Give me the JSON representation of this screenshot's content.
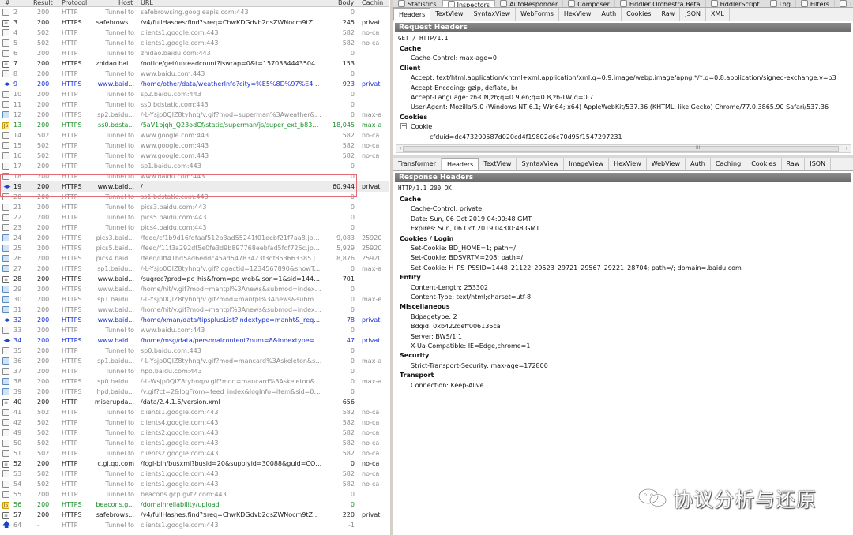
{
  "session_list": {
    "columns": [
      "#",
      "Result",
      "Protocol",
      "Host",
      "URL",
      "Body",
      "Cachin"
    ],
    "rows": [
      {
        "num": "2",
        "result": "200",
        "protocol": "HTTP",
        "host": "Tunnel to",
        "url": "safebrowsing.googleapis.com:443",
        "body": "0",
        "caching": "",
        "style": "tunnel",
        "icon": "lock-icon"
      },
      {
        "num": "3",
        "result": "200",
        "protocol": "HTTPS",
        "host": "safebrows...",
        "url": "/v4/fullHashes:find?$req=ChwKDGdvb2dsZWNocm9tZRIMN...",
        "body": "245",
        "caching": "privat",
        "style": "normal",
        "icon": "document-icon"
      },
      {
        "num": "4",
        "result": "502",
        "protocol": "HTTP",
        "host": "Tunnel to",
        "url": "clients1.google.com:443",
        "body": "582",
        "caching": "no-ca",
        "style": "tunnel",
        "icon": "lock-icon"
      },
      {
        "num": "5",
        "result": "502",
        "protocol": "HTTP",
        "host": "Tunnel to",
        "url": "clients1.google.com:443",
        "body": "582",
        "caching": "no-ca",
        "style": "tunnel",
        "icon": "lock-icon"
      },
      {
        "num": "6",
        "result": "200",
        "protocol": "HTTP",
        "host": "Tunnel to",
        "url": "zhidao.baidu.com:443",
        "body": "0",
        "caching": "",
        "style": "tunnel",
        "icon": "lock-icon"
      },
      {
        "num": "7",
        "result": "200",
        "protocol": "HTTPS",
        "host": "zhidao.bai...",
        "url": "/notice/get/unreadcount?iswrap=0&t=1570334443504",
        "body": "153",
        "caching": "",
        "style": "normal",
        "icon": "document-icon"
      },
      {
        "num": "8",
        "result": "200",
        "protocol": "HTTP",
        "host": "Tunnel to",
        "url": "www.baidu.com:443",
        "body": "0",
        "caching": "",
        "style": "tunnel",
        "icon": "lock-icon"
      },
      {
        "num": "9",
        "result": "200",
        "protocol": "HTTPS",
        "host": "www.baid...",
        "url": "/home/other/data/weatherInfo?city=%E5%8D%97%E4%...",
        "body": "923",
        "caching": "privat",
        "style": "blue",
        "icon": "json-icon"
      },
      {
        "num": "10",
        "result": "200",
        "protocol": "HTTP",
        "host": "Tunnel to",
        "url": "sp2.baidu.com:443",
        "body": "0",
        "caching": "",
        "style": "tunnel",
        "icon": "lock-icon"
      },
      {
        "num": "11",
        "result": "200",
        "protocol": "HTTP",
        "host": "Tunnel to",
        "url": "ss0.bdstatic.com:443",
        "body": "0",
        "caching": "",
        "style": "tunnel",
        "icon": "lock-icon"
      },
      {
        "num": "12",
        "result": "200",
        "protocol": "HTTPS",
        "host": "sp2.baidu...",
        "url": "/-L-Ysjp0QIZ8tyhnq/v.gif?mod=superman%3Aweather&su...",
        "body": "0",
        "caching": "max-a",
        "style": "tunnel",
        "icon": "image-icon"
      },
      {
        "num": "13",
        "result": "200",
        "protocol": "HTTPS",
        "host": "ss0.bdsta...",
        "url": "/5aV1bjqh_Q23odCf/static/superman/js/super_ext_b83d27...",
        "body": "18,045",
        "caching": "max-a",
        "style": "green",
        "icon": "script-icon"
      },
      {
        "num": "14",
        "result": "502",
        "protocol": "HTTP",
        "host": "Tunnel to",
        "url": "www.google.com:443",
        "body": "582",
        "caching": "no-ca",
        "style": "tunnel",
        "icon": "lock-icon"
      },
      {
        "num": "15",
        "result": "502",
        "protocol": "HTTP",
        "host": "Tunnel to",
        "url": "www.google.com:443",
        "body": "582",
        "caching": "no-ca",
        "style": "tunnel",
        "icon": "lock-icon"
      },
      {
        "num": "16",
        "result": "502",
        "protocol": "HTTP",
        "host": "Tunnel to",
        "url": "www.google.com:443",
        "body": "582",
        "caching": "no-ca",
        "style": "tunnel",
        "icon": "lock-icon"
      },
      {
        "num": "17",
        "result": "200",
        "protocol": "HTTP",
        "host": "Tunnel to",
        "url": "sp1.baidu.com:443",
        "body": "0",
        "caching": "",
        "style": "tunnel",
        "icon": "lock-icon"
      },
      {
        "num": "18",
        "result": "200",
        "protocol": "HTTP",
        "host": "Tunnel to",
        "url": "www.baidu.com:443",
        "body": "0",
        "caching": "",
        "style": "tunnel",
        "icon": "lock-icon"
      },
      {
        "num": "19",
        "result": "200",
        "protocol": "HTTPS",
        "host": "www.baid...",
        "url": "/",
        "body": "60,944",
        "caching": "privat",
        "style": "bold sel",
        "icon": "transfer-icon"
      },
      {
        "num": "20",
        "result": "200",
        "protocol": "HTTP",
        "host": "Tunnel to",
        "url": "ss1.bdstatic.com:443",
        "body": "0",
        "caching": "",
        "style": "tunnel",
        "icon": "lock-icon"
      },
      {
        "num": "21",
        "result": "200",
        "protocol": "HTTP",
        "host": "Tunnel to",
        "url": "pics3.baidu.com:443",
        "body": "0",
        "caching": "",
        "style": "tunnel",
        "icon": "lock-icon"
      },
      {
        "num": "22",
        "result": "200",
        "protocol": "HTTP",
        "host": "Tunnel to",
        "url": "pics5.baidu.com:443",
        "body": "0",
        "caching": "",
        "style": "tunnel",
        "icon": "lock-icon"
      },
      {
        "num": "23",
        "result": "200",
        "protocol": "HTTP",
        "host": "Tunnel to",
        "url": "pics4.baidu.com:443",
        "body": "0",
        "caching": "",
        "style": "tunnel",
        "icon": "lock-icon"
      },
      {
        "num": "24",
        "result": "200",
        "protocol": "HTTPS",
        "host": "pics3.baid...",
        "url": "/feed/cf1b9d16fdfaaf512b3ad55241f01eebf21f7aa8.jpeg?...",
        "body": "9,083",
        "caching": "25920",
        "style": "tunnel",
        "icon": "image-icon"
      },
      {
        "num": "25",
        "result": "200",
        "protocol": "HTTPS",
        "host": "pics5.baid...",
        "url": "/feed/f11f3a292df5e0fe3d9b897768eebfad5fdf725c.jpeg?...",
        "body": "5,929",
        "caching": "25920",
        "style": "tunnel",
        "icon": "image-icon"
      },
      {
        "num": "26",
        "result": "200",
        "protocol": "HTTPS",
        "host": "pics4.baid...",
        "url": "/feed/0ff41bd5ad6eddc45ad54783423f3df853663385.jpeg...",
        "body": "8,876",
        "caching": "25920",
        "style": "tunnel",
        "icon": "image-icon"
      },
      {
        "num": "27",
        "result": "200",
        "protocol": "HTTPS",
        "host": "sp1.baidu...",
        "url": "/-L-Ysjp0QIZ8tyhnq/v.gif?logactid=1234567890&showTab...",
        "body": "0",
        "caching": "max-a",
        "style": "tunnel",
        "icon": "image-icon"
      },
      {
        "num": "28",
        "result": "200",
        "protocol": "HTTPS",
        "host": "www.baid...",
        "url": "/sugrec?prod=pc_his&from=pc_web&json=1&sid=1448_21...",
        "body": "701",
        "caching": "",
        "style": "normal",
        "icon": "document-icon"
      },
      {
        "num": "29",
        "result": "200",
        "protocol": "HTTPS",
        "host": "www.baid...",
        "url": "/home/hit/v.gif?mod=mantpl%3Anews&submod=index&uty...",
        "body": "0",
        "caching": "",
        "style": "tunnel",
        "icon": "image-icon"
      },
      {
        "num": "30",
        "result": "200",
        "protocol": "HTTPS",
        "host": "sp1.baidu...",
        "url": "/-L-Ysjp0QIZ8tyhnq/v.gif?mod=mantpl%3Anews&submod...",
        "body": "0",
        "caching": "max-e",
        "style": "tunnel",
        "icon": "image-icon"
      },
      {
        "num": "31",
        "result": "200",
        "protocol": "HTTPS",
        "host": "www.baid...",
        "url": "/home/hit/v.gif?mod=mantpl%3Anews&submod=index&uty...",
        "body": "0",
        "caching": "",
        "style": "tunnel",
        "icon": "image-icon"
      },
      {
        "num": "32",
        "result": "200",
        "protocol": "HTTPS",
        "host": "www.baid...",
        "url": "/home/xman/data/tipsplusList?indextype=manht&_req_seqi...",
        "body": "78",
        "caching": "privat",
        "style": "blue",
        "icon": "json-icon"
      },
      {
        "num": "33",
        "result": "200",
        "protocol": "HTTP",
        "host": "Tunnel to",
        "url": "www.baidu.com:443",
        "body": "0",
        "caching": "",
        "style": "tunnel",
        "icon": "lock-icon"
      },
      {
        "num": "34",
        "result": "200",
        "protocol": "HTTPS",
        "host": "www.baid...",
        "url": "/home/msg/data/personalcontent?num=8&indextype=man...",
        "body": "47",
        "caching": "privat",
        "style": "blue",
        "icon": "json-icon"
      },
      {
        "num": "35",
        "result": "200",
        "protocol": "HTTP",
        "host": "Tunnel to",
        "url": "sp0.baidu.com:443",
        "body": "0",
        "caching": "",
        "style": "tunnel",
        "icon": "lock-icon"
      },
      {
        "num": "36",
        "result": "200",
        "protocol": "HTTPS",
        "host": "sp1.baidu...",
        "url": "/-L-Ysjp0QIZ8tyhnq/v.gif?mod=mancard%3Askeleton&sub...",
        "body": "0",
        "caching": "max-a",
        "style": "tunnel",
        "icon": "image-icon"
      },
      {
        "num": "37",
        "result": "200",
        "protocol": "HTTP",
        "host": "Tunnel to",
        "url": "hpd.baidu.com:443",
        "body": "0",
        "caching": "",
        "style": "tunnel",
        "icon": "lock-icon"
      },
      {
        "num": "38",
        "result": "200",
        "protocol": "HTTPS",
        "host": "sp0.baidu...",
        "url": "/-L-Wsjp0QIZ8tyhnq/v.gif?mod=mancard%3Askeleton&su...",
        "body": "0",
        "caching": "max-a",
        "style": "tunnel",
        "icon": "image-icon"
      },
      {
        "num": "39",
        "result": "200",
        "protocol": "HTTPS",
        "host": "hpd.baidu...",
        "url": "/v.gif?ct=2&logFrom=feed_index&logInfo=item&sid=0xb4...",
        "body": "0",
        "caching": "",
        "style": "tunnel",
        "icon": "image-icon"
      },
      {
        "num": "40",
        "result": "200",
        "protocol": "HTTP",
        "host": "miserupda...",
        "url": "/data/2.4.1.6/version.xml",
        "body": "656",
        "caching": "",
        "style": "normal",
        "icon": "xml-icon"
      },
      {
        "num": "41",
        "result": "502",
        "protocol": "HTTP",
        "host": "Tunnel to",
        "url": "clients1.google.com:443",
        "body": "582",
        "caching": "no-ca",
        "style": "tunnel",
        "icon": "lock-icon"
      },
      {
        "num": "42",
        "result": "502",
        "protocol": "HTTP",
        "host": "Tunnel to",
        "url": "clients4.google.com:443",
        "body": "582",
        "caching": "no-ca",
        "style": "tunnel",
        "icon": "lock-icon"
      },
      {
        "num": "49",
        "result": "502",
        "protocol": "HTTP",
        "host": "Tunnel to",
        "url": "clients2.google.com:443",
        "body": "582",
        "caching": "no-ca",
        "style": "tunnel",
        "icon": "lock-icon"
      },
      {
        "num": "50",
        "result": "502",
        "protocol": "HTTP",
        "host": "Tunnel to",
        "url": "clients1.google.com:443",
        "body": "582",
        "caching": "no-ca",
        "style": "tunnel",
        "icon": "lock-icon"
      },
      {
        "num": "51",
        "result": "502",
        "protocol": "HTTP",
        "host": "Tunnel to",
        "url": "clients2.google.com:443",
        "body": "582",
        "caching": "no-ca",
        "style": "tunnel",
        "icon": "lock-icon"
      },
      {
        "num": "52",
        "result": "200",
        "protocol": "HTTP",
        "host": "c.gj.qq.com",
        "url": "/fcgi-bin/busxml?busid=20&supplyid=30088&guid=CQEjCF...",
        "body": "0",
        "caching": "no-ca",
        "style": "normal",
        "icon": "document-icon"
      },
      {
        "num": "53",
        "result": "502",
        "protocol": "HTTP",
        "host": "Tunnel to",
        "url": "clients1.google.com:443",
        "body": "582",
        "caching": "no-ca",
        "style": "tunnel",
        "icon": "lock-icon"
      },
      {
        "num": "54",
        "result": "502",
        "protocol": "HTTP",
        "host": "Tunnel to",
        "url": "clients1.google.com:443",
        "body": "582",
        "caching": "no-ca",
        "style": "tunnel",
        "icon": "lock-icon"
      },
      {
        "num": "55",
        "result": "200",
        "protocol": "HTTP",
        "host": "Tunnel to",
        "url": "beacons.gcp.gvt2.com:443",
        "body": "0",
        "caching": "",
        "style": "tunnel",
        "icon": "lock-icon"
      },
      {
        "num": "56",
        "result": "200",
        "protocol": "HTTPS",
        "host": "beacons.g...",
        "url": "/domainreliability/upload",
        "body": "0",
        "caching": "",
        "style": "green",
        "icon": "script-icon"
      },
      {
        "num": "57",
        "result": "200",
        "protocol": "HTTPS",
        "host": "safebrows...",
        "url": "/v4/fullHashes:find?$req=ChwKDGdvb2dsZWNocm9tZRIMN...",
        "body": "220",
        "caching": "privat",
        "style": "normal",
        "icon": "document-icon"
      },
      {
        "num": "64",
        "result": "-",
        "protocol": "HTTP",
        "host": "Tunnel to",
        "url": "clients1.google.com:443",
        "body": "-1",
        "caching": "",
        "style": "tunnel",
        "icon": "upload-icon"
      }
    ]
  },
  "top_tabs": [
    "Statistics",
    "Inspectors",
    "AutoResponder",
    "Composer",
    "Fiddler Orchestra Beta",
    "FiddlerScript",
    "Log",
    "Filters",
    "Timel"
  ],
  "request_tabs": [
    "Headers",
    "TextView",
    "SyntaxView",
    "WebForms",
    "HexView",
    "Auth",
    "Cookies",
    "Raw",
    "JSON",
    "XML"
  ],
  "request": {
    "section_title": "Request Headers",
    "request_line": "GET / HTTP/1.1",
    "groups": [
      {
        "name": "Cache",
        "headers": [
          "Cache-Control: max-age=0"
        ]
      },
      {
        "name": "Client",
        "headers": [
          "Accept: text/html,application/xhtml+xml,application/xml;q=0.9,image/webp,image/apng,*/*;q=0.8,application/signed-exchange;v=b3",
          "Accept-Encoding: gzip, deflate, br",
          "Accept-Language: zh-CN,zh;q=0.9,en;q=0.8,zh-TW;q=0.7",
          "User-Agent: Mozilla/5.0 (Windows NT 6.1; Win64; x64) AppleWebKit/537.36 (KHTML, like Gecko) Chrome/77.0.3865.90 Safari/537.36"
        ]
      },
      {
        "name": "Cookies",
        "headers": []
      }
    ],
    "cookie_label": "Cookie",
    "cookie_toggle": "−",
    "cookie_value": "__cfduid=dc473200587d020cd4f19802d6c70d95f1547297231"
  },
  "response_tabs": [
    "Transformer",
    "Headers",
    "TextView",
    "SyntaxView",
    "ImageView",
    "HexView",
    "WebView",
    "Auth",
    "Caching",
    "Cookies",
    "Raw",
    "JSON"
  ],
  "response": {
    "section_title": "Response Headers",
    "status_line": "HTTP/1.1 200 OK",
    "groups": [
      {
        "name": "Cache",
        "headers": [
          "Cache-Control: private",
          "Date: Sun, 06 Oct 2019 04:00:48 GMT",
          "Expires: Sun, 06 Oct 2019 04:00:48 GMT"
        ]
      },
      {
        "name": "Cookies / Login",
        "headers": [
          "Set-Cookie: BD_HOME=1; path=/",
          "Set-Cookie: BDSVRTM=208; path=/",
          "Set-Cookie: H_PS_PSSID=1448_21122_29523_29721_29567_29221_28704; path=/; domain=.baidu.com"
        ]
      },
      {
        "name": "Entity",
        "headers": [
          "Content-Length: 253302",
          "Content-Type: text/html;charset=utf-8"
        ]
      },
      {
        "name": "Miscellaneous",
        "headers": [
          "Bdpagetype: 2",
          "Bdqid: 0xb422deff006135ca",
          "Server: BWS/1.1",
          "X-Ua-Compatible: IE=Edge,chrome=1"
        ]
      },
      {
        "name": "Security",
        "headers": [
          "Strict-Transport-Security: max-age=172800"
        ]
      },
      {
        "name": "Transport",
        "headers": [
          "Connection: Keep-Alive"
        ]
      }
    ]
  },
  "scrollbar": {
    "left_arrow": "‹",
    "right_arrow": "›",
    "grip": "III"
  },
  "watermark": {
    "text": "协议分析与还原",
    "icon": "wechat-icon"
  }
}
